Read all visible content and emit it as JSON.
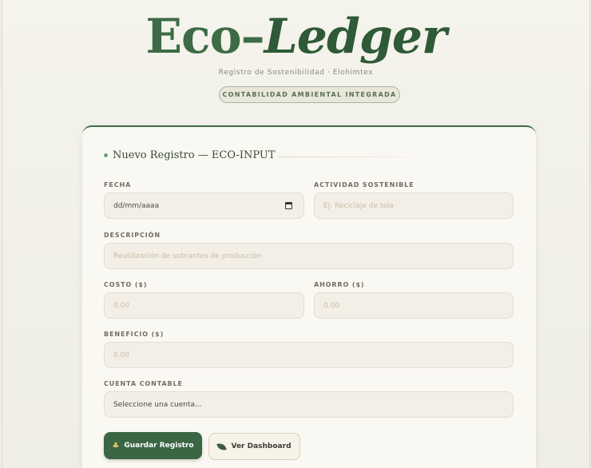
{
  "header": {
    "brand_part1": "Eco",
    "brand_dash": "–",
    "brand_part2": "Ledger",
    "subtitle": "Registro de Sostenibilidad · Elohimtex",
    "pill": "CONTABILIDAD AMBIENTAL INTEGRADA"
  },
  "form": {
    "title": "Nuevo Registro — ECO-INPUT",
    "fecha": {
      "label": "FECHA",
      "value": "dd/mm/aaaa"
    },
    "actividad": {
      "label": "ACTIVIDAD SOSTENIBLE",
      "placeholder": "Ej: Reciclaje de tela"
    },
    "descripcion": {
      "label": "DESCRIPCIÓN",
      "placeholder": "Reutilización de sobrantes de producción"
    },
    "costo": {
      "label": "COSTO ($)",
      "placeholder": "0.00"
    },
    "ahorro": {
      "label": "AHORRO ($)",
      "placeholder": "0.00"
    },
    "beneficio": {
      "label": "BENEFICIO ($)",
      "placeholder": "0.00"
    },
    "cuenta": {
      "label": "CUENTA CONTABLE",
      "selected": "Seleccione una cuenta..."
    }
  },
  "buttons": {
    "save_icon": "sprout-icon",
    "save_label": "Guardar Registro",
    "dashboard_icon": "leaf-icon",
    "dashboard_label": "Ver Dashboard"
  },
  "colors": {
    "brand_green": "#3d6b45",
    "primary_button": "#3a6643",
    "field_bg": "#f3efe6"
  }
}
